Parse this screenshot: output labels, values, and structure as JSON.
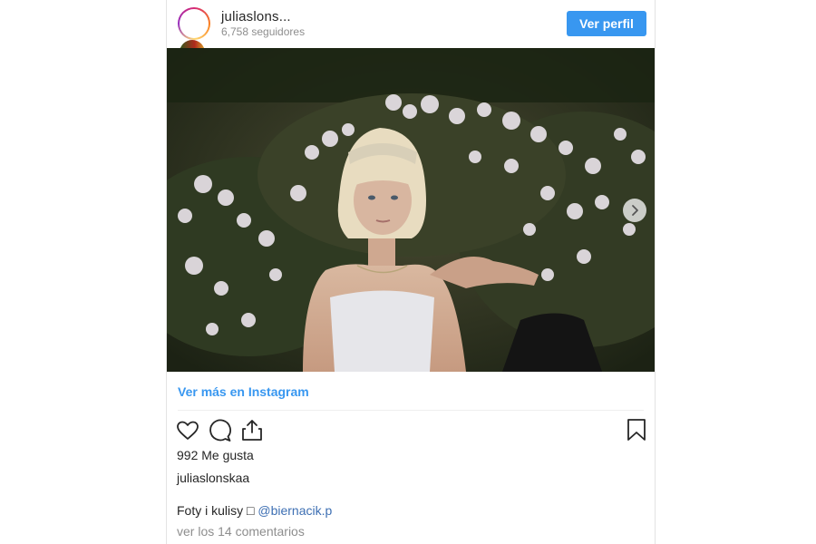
{
  "header": {
    "username": "juliaslons...",
    "followers": "6,758 seguidores",
    "profile_button": "Ver perfil"
  },
  "post": {
    "view_more_link": "Ver más en Instagram",
    "likes": "992 Me gusta",
    "owner": "juliaslonskaa",
    "caption_text": "Foty i kulisy □",
    "caption_mention": "@biernacik.p",
    "comments_link": "ver los 14 comentarios"
  },
  "icons": {
    "like": "heart-icon",
    "comment": "comment-icon",
    "share": "share-icon",
    "save": "bookmark-icon",
    "next": "chevron-right-icon"
  },
  "colors": {
    "accent_blue": "#3897f0",
    "text": "#262626",
    "muted": "#8e8e8e"
  }
}
